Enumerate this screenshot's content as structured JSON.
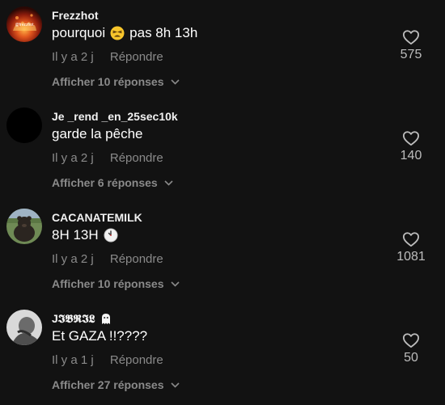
{
  "comments": [
    {
      "username": "Frezzhot",
      "text_before": "pourquoi",
      "text_emoji": "tired-face-emoji",
      "text_after": "pas 8h 13h",
      "age": "Il y a 2 j",
      "reply_label": "Répondre",
      "replies_label": "Afficher 10 réponses",
      "likes": "575",
      "avatar_icon": "fire-avatar",
      "avatar_watermark": "@frezzhot"
    },
    {
      "username": "Je _rend _en_25sec10k",
      "text_before": "garde la pêche",
      "text_emoji": "",
      "text_after": "",
      "age": "Il y a 2 j",
      "reply_label": "Répondre",
      "replies_label": "Afficher 6 réponses",
      "likes": "140",
      "avatar_icon": "black-avatar"
    },
    {
      "username": "CACANATEMILK",
      "text_before": "8H 13H",
      "text_emoji": "clock-emoji",
      "text_after": "",
      "age": "Il y a 2 j",
      "reply_label": "Répondre",
      "replies_label": "Afficher 10 réponses",
      "likes": "1081",
      "avatar_icon": "bear-avatar"
    },
    {
      "username": "J𝕴𝕭𝕽𝕴𝕷",
      "username_emoji": "ghost-emoji",
      "text_before": "Et GAZA !!????",
      "text_emoji": "",
      "text_after": "",
      "age": "Il y a 1 j",
      "reply_label": "Répondre",
      "replies_label": "Afficher 27 réponses",
      "likes": "50",
      "avatar_icon": "gray-photo-avatar"
    }
  ],
  "colors": {
    "background": "#121212",
    "muted": "#8a8a8a",
    "text": "#ffffff"
  }
}
